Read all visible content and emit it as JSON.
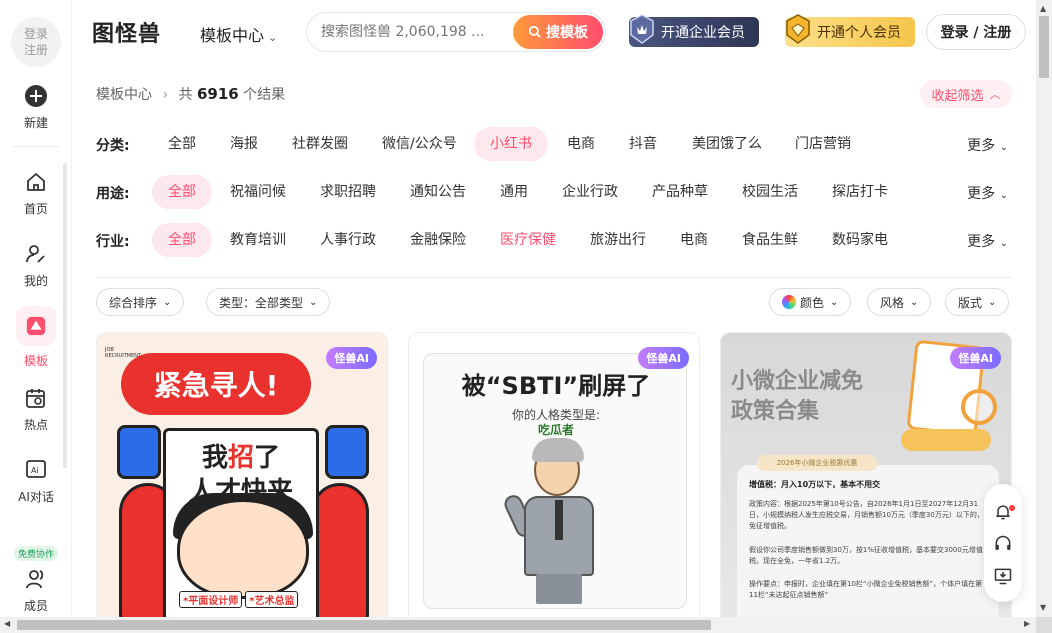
{
  "sidebar": {
    "login": [
      "登录",
      "注册"
    ],
    "items": [
      {
        "label": "新建",
        "icon": "plus-circle-icon"
      },
      {
        "label": "首页",
        "icon": "home-icon"
      },
      {
        "label": "我的",
        "icon": "user-edit-icon"
      },
      {
        "label": "模板",
        "icon": "template-icon",
        "active": true
      },
      {
        "label": "热点",
        "icon": "calendar-search-icon"
      },
      {
        "label": "AI对话",
        "icon": "ai-chat-icon"
      },
      {
        "label": "成员",
        "icon": "members-icon",
        "badge": "免费协作"
      }
    ]
  },
  "header": {
    "logo": "图怪兽",
    "nav_label": "模板中心",
    "search_placeholder": "搜索图怪兽 2,060,198 ...",
    "search_button": "搜模板",
    "vip_enterprise": "开通企业会员",
    "vip_personal": "开通个人会员",
    "login_button": "登录 / 注册"
  },
  "breadcrumb": {
    "root": "模板中心",
    "prefix": "共",
    "count": "6916",
    "suffix": "个结果"
  },
  "collapse_label": "收起筛选",
  "filters": [
    {
      "label": "分类:",
      "options": [
        "全部",
        "海报",
        "社群发圈",
        "微信/公众号",
        "小红书",
        "电商",
        "抖音",
        "美团饿了么",
        "门店营销"
      ],
      "selected": 4,
      "more": "更多"
    },
    {
      "label": "用途:",
      "options": [
        "全部",
        "祝福问候",
        "求职招聘",
        "通知公告",
        "通用",
        "企业行政",
        "产品种草",
        "校园生活",
        "探店打卡"
      ],
      "selected": 0,
      "more": "更多"
    },
    {
      "label": "行业:",
      "options": [
        "全部",
        "教育培训",
        "人事行政",
        "金融保险",
        "医疗保健",
        "旅游出行",
        "电商",
        "食品生鲜",
        "数码家电"
      ],
      "selected": 0,
      "highlight": 4,
      "more": "更多"
    }
  ],
  "toolbar": {
    "sort": "综合排序",
    "type": "类型：全部类型",
    "color": "颜色",
    "style": "风格",
    "layout": "版式"
  },
  "cards": [
    {
      "ai_tag": "怪兽AI",
      "headline": "紧急寻人!",
      "sign_line1": "我",
      "sign_red": "招",
      "sign_line1b": "了",
      "sign_line2": "人才快来",
      "tag1": "*平面设计师",
      "tag2": "*艺术总监",
      "corner": "JOB RECRUITMENT"
    },
    {
      "ai_tag": "怪兽AI",
      "title": "被“SBTI”刷屏了",
      "sub": "你的人格类型是:",
      "sub2": "吃瓜者"
    },
    {
      "ai_tag": "怪兽AI",
      "title_1": "小微企业减免",
      "title_2": "政策合集",
      "pill": "2026年小微企业税惠优惠",
      "line1_bold": "增值税：月入10万以下，基本不用交",
      "line2": "政策内容：根据2025年第10号公告，自2026年1月1日至2027年12月31日，小规模纳税人发生应税交易，月销售额10万元（季度30万元）以下的，免征增值税。",
      "line3": "假设你公司季度销售额做到30万，按1%征收增值税，基本要交3000元增值税。现在全免，一年省1.2万。",
      "line4": "操作要点：申报时，企业填在第10栏“小微企业免税销售额”，个体户填在第11栏“未达起征点销售额”"
    }
  ],
  "colors": {
    "accent": "#ff4d6d",
    "accent_bg": "#fde8ee"
  }
}
